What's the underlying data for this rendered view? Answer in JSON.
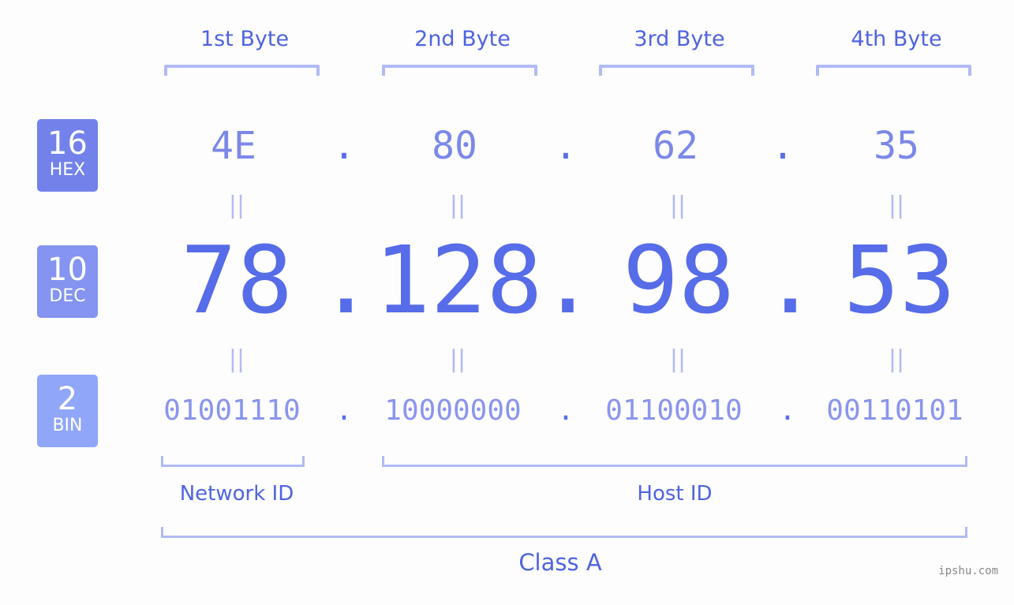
{
  "bytes": [
    {
      "label": "1st Byte",
      "hex": "4E",
      "dec": "78",
      "bin": "01001110"
    },
    {
      "label": "2nd Byte",
      "hex": "80",
      "dec": "128",
      "bin": "10000000"
    },
    {
      "label": "3rd Byte",
      "hex": "62",
      "dec": "98",
      "bin": "01100010"
    },
    {
      "label": "4th Byte",
      "hex": "35",
      "dec": "53",
      "bin": "00110101"
    }
  ],
  "separator": ".",
  "equals_glyph": "||",
  "badges": {
    "hex": {
      "number": "16",
      "label": "HEX",
      "color": "#7382ea"
    },
    "dec": {
      "number": "10",
      "label": "DEC",
      "color": "#8494f0"
    },
    "bin": {
      "number": "2",
      "label": "BIN",
      "color": "#90a6f8"
    }
  },
  "segments": {
    "network": "Network ID",
    "host": "Host ID",
    "class": "Class A"
  },
  "watermark": "ipshu.com",
  "colors": {
    "accent": "#566ce8",
    "bracket": "#b2baf5"
  }
}
